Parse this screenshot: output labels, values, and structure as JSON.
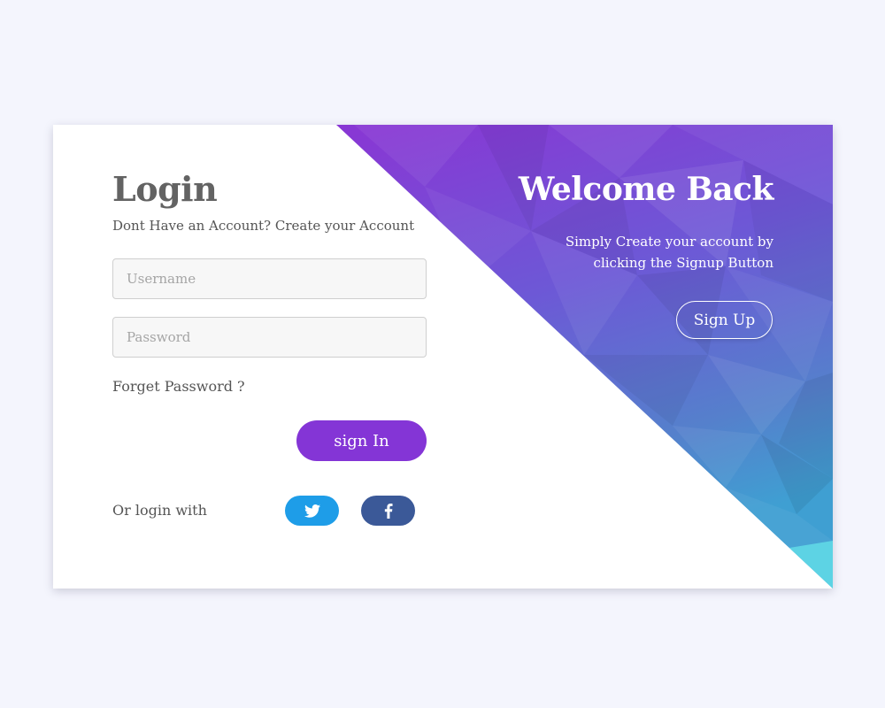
{
  "login": {
    "title": "Login",
    "subtitle": "Dont Have an Account? Create your Account",
    "username_placeholder": "Username",
    "password_placeholder": "Password",
    "forget_password": "Forget Password ?",
    "signin_label": "sign In",
    "or_login_with": "Or login with",
    "social": [
      {
        "icon": "twitter-icon",
        "color": "#1e9de8"
      },
      {
        "icon": "facebook-icon",
        "color": "#3b5998"
      }
    ]
  },
  "welcome": {
    "title": "Welcome Back",
    "text": "Simply Create your account by clicking the Signup Button",
    "signup_label": "Sign Up"
  },
  "colors": {
    "accent": "#8435d6",
    "gradient_top": "#8b36d2",
    "gradient_mid": "#6a5cd6",
    "gradient_bottom": "#4aa2d8",
    "page_background": "#f4f5fd"
  }
}
